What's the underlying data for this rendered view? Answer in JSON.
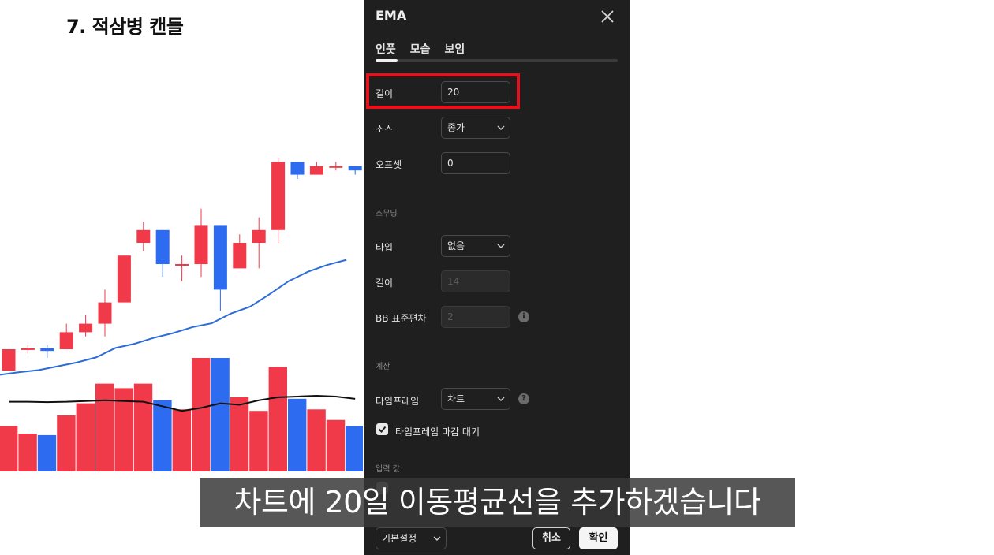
{
  "page_title": "7. 적삼병 캔들",
  "dialog": {
    "title": "EMA",
    "tabs": [
      {
        "label": "인풋",
        "active": true
      },
      {
        "label": "모습",
        "active": false
      },
      {
        "label": "보임",
        "active": false
      }
    ],
    "length": {
      "label": "길이",
      "value": "20"
    },
    "source": {
      "label": "소스",
      "value": "종가"
    },
    "offset": {
      "label": "오프셋",
      "value": "0"
    },
    "smoothing": {
      "section": "스무딩",
      "type": {
        "label": "타입",
        "value": "없음"
      },
      "length": {
        "label": "길이",
        "value": "14"
      },
      "bb_stddev": {
        "label": "BB 표준편차",
        "value": "2"
      }
    },
    "calc": {
      "section": "계산",
      "timeframe": {
        "label": "타임프레임",
        "value": "차트"
      },
      "wait_close": {
        "label": "타임프레임 마감 대기",
        "checked": true
      }
    },
    "inputs_section": "입력 값",
    "footer": {
      "defaults": "기본설정",
      "cancel": "취소",
      "ok": "확인"
    },
    "info_icon": "i",
    "help_icon": "?"
  },
  "subtitle": "차트에 20일 이동평균선을 추가하겠습니다",
  "colors": {
    "up": "#f03a4a",
    "down": "#2d6cf0",
    "ema": "#2d6cd8",
    "volume_ma": "#111111",
    "highlight": "#e8101a",
    "panel": "#1f1f1f"
  },
  "chart_data": {
    "type": "candlestick",
    "candles": [
      {
        "o": 95,
        "h": 100,
        "l": 95,
        "c": 100
      },
      {
        "o": 100,
        "h": 101,
        "l": 99,
        "c": 100.2
      },
      {
        "o": 100.2,
        "h": 101,
        "l": 98,
        "c": 99.6
      },
      {
        "o": 100,
        "h": 106,
        "l": 100,
        "c": 104
      },
      {
        "o": 104,
        "h": 108,
        "l": 103,
        "c": 106
      },
      {
        "o": 106,
        "h": 114,
        "l": 103,
        "c": 111
      },
      {
        "o": 111,
        "h": 122,
        "l": 111,
        "c": 122
      },
      {
        "o": 125,
        "h": 130,
        "l": 123,
        "c": 128
      },
      {
        "o": 128,
        "h": 128,
        "l": 117,
        "c": 120
      },
      {
        "o": 120,
        "h": 122,
        "l": 116,
        "c": 120
      },
      {
        "o": 120,
        "h": 133,
        "l": 117,
        "c": 129
      },
      {
        "o": 129,
        "h": 129,
        "l": 109,
        "c": 114
      },
      {
        "o": 119,
        "h": 127,
        "l": 119,
        "c": 125
      },
      {
        "o": 125,
        "h": 131,
        "l": 119,
        "c": 128
      },
      {
        "o": 128,
        "h": 145,
        "l": 125,
        "c": 144
      },
      {
        "o": 144,
        "h": 144,
        "l": 140,
        "c": 141
      },
      {
        "o": 141,
        "h": 144,
        "l": 141,
        "c": 143
      },
      {
        "o": 143,
        "h": 144,
        "l": 142,
        "c": 143
      },
      {
        "o": 143,
        "h": 143,
        "l": 141,
        "c": 142
      }
    ],
    "ema": [
      94,
      94.6,
      95.1,
      96.0,
      96.9,
      98.1,
      100.3,
      101.3,
      102.7,
      103.8,
      105.2,
      106.1,
      108.4,
      110.0,
      112.9,
      116.0,
      118.2,
      119.8,
      121.0
    ],
    "volume": [
      30,
      25,
      24,
      37,
      45,
      58,
      55,
      58,
      47,
      41,
      75,
      75,
      49,
      40,
      69,
      48,
      41,
      34,
      30
    ],
    "volume_ma": [
      46,
      46,
      45.8,
      46,
      46.5,
      47,
      46.5,
      46,
      43,
      40,
      42,
      45,
      44,
      47,
      49,
      49.5,
      50,
      49.5,
      48
    ]
  }
}
